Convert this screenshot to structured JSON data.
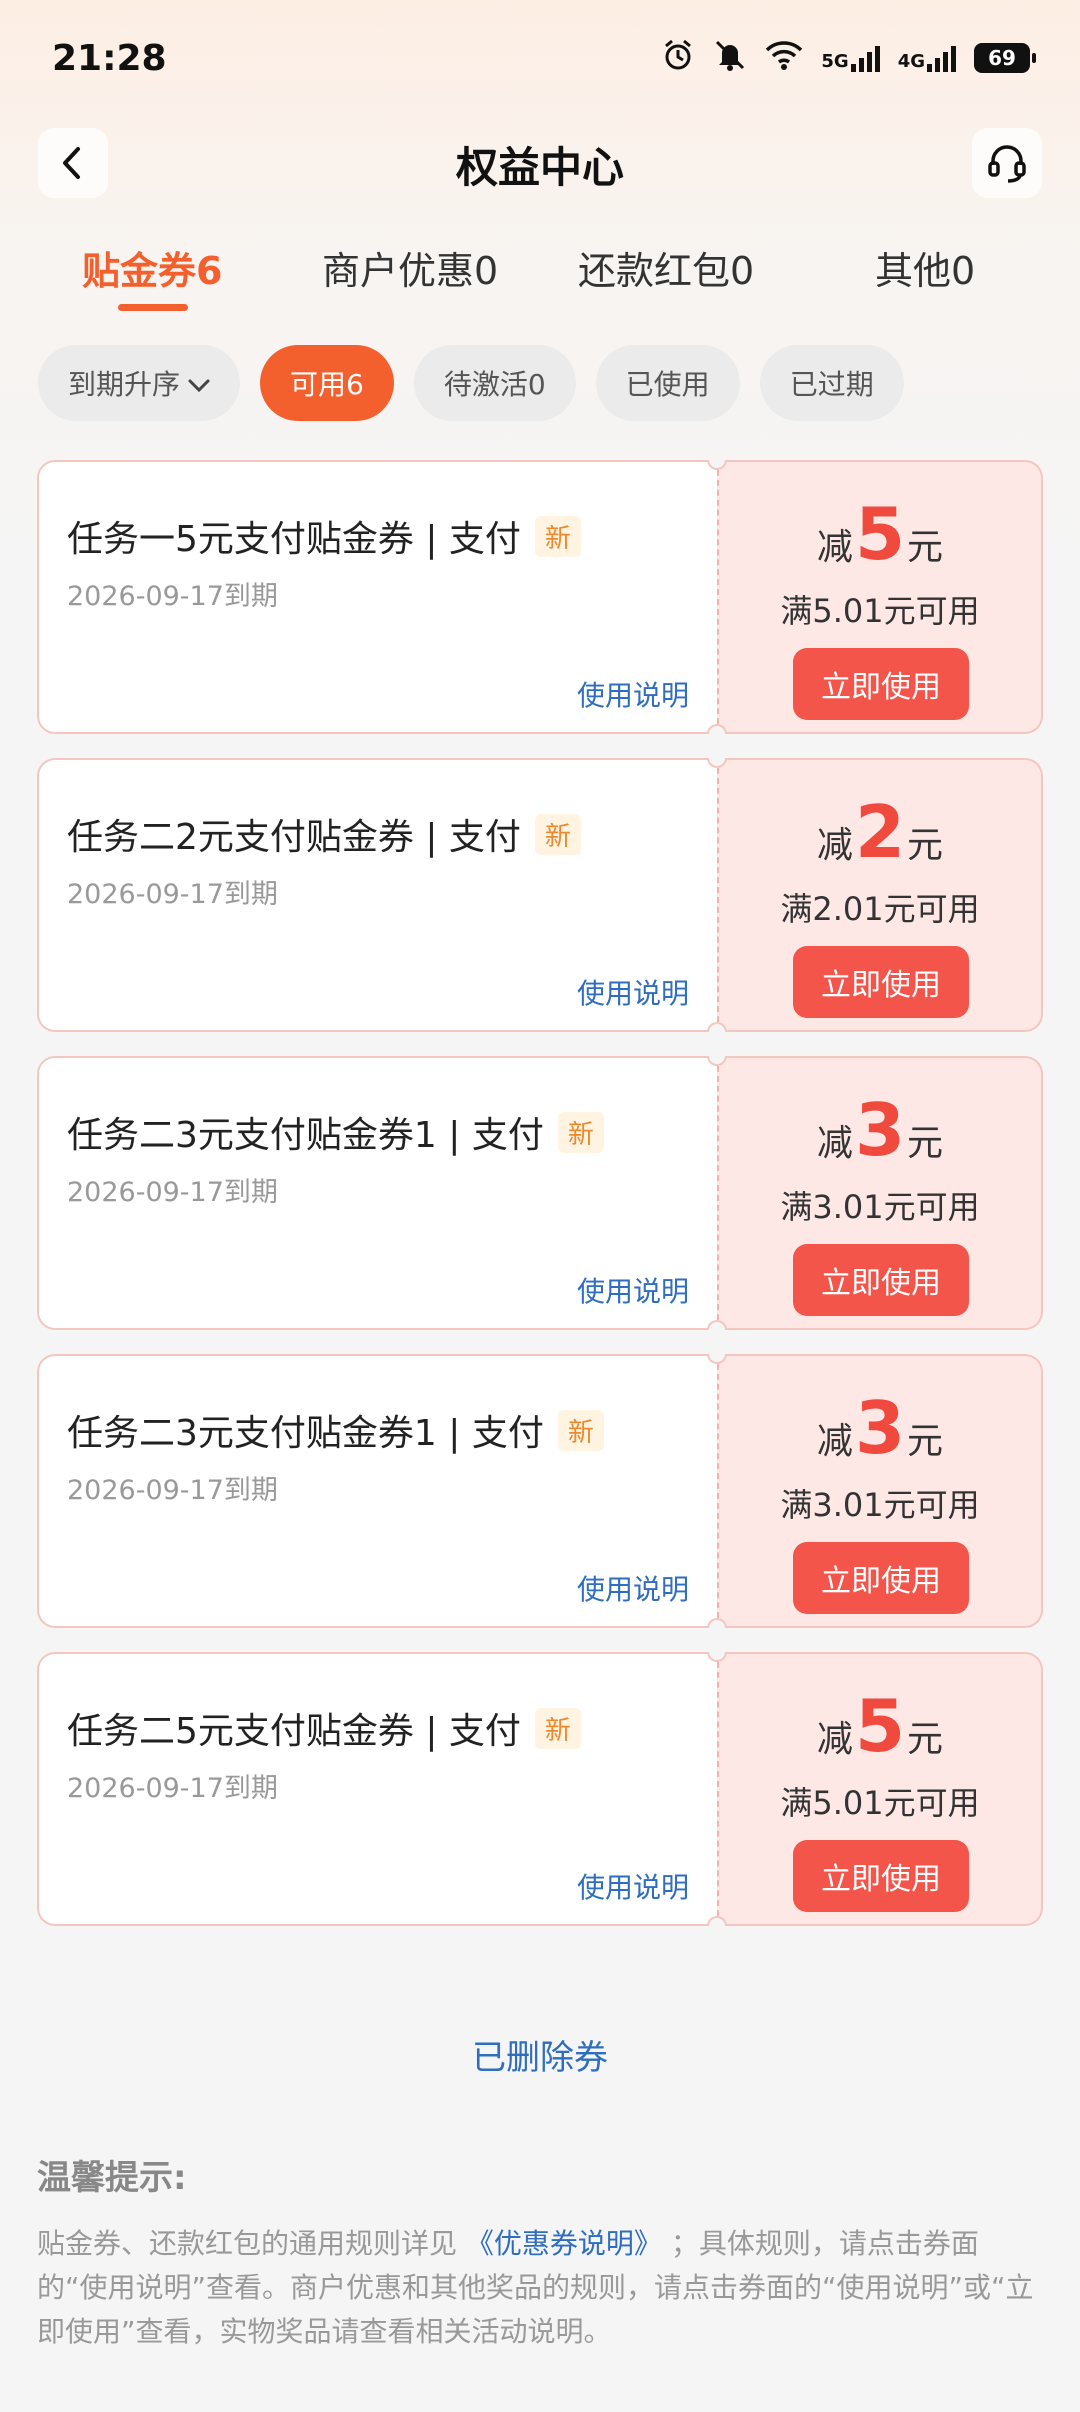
{
  "status": {
    "time": "21:28",
    "net1": "5G",
    "net2": "4G",
    "battery": "69"
  },
  "nav": {
    "title": "权益中心",
    "back_icon": "chevron-left-icon",
    "service_icon": "headset-icon"
  },
  "tabs": [
    {
      "label": "贴金券6",
      "active": true
    },
    {
      "label": "商户优惠0",
      "active": false
    },
    {
      "label": "还款红包0",
      "active": false
    },
    {
      "label": "其他0",
      "active": false
    }
  ],
  "filters": {
    "sort": "到期升序",
    "chips": [
      "可用6",
      "待激活0",
      "已使用",
      "已过期"
    ],
    "active_chip": "可用6"
  },
  "coupons": [
    {
      "title": "任务一5元支付贴金券 | 支付",
      "badge": "新",
      "expire": "2026-09-17到期",
      "help": "使用说明",
      "prefix": "减",
      "amount": "5",
      "suffix": "元",
      "condition": "满5.01元可用",
      "button": "立即使用"
    },
    {
      "title": "任务二2元支付贴金券 | 支付",
      "badge": "新",
      "expire": "2026-09-17到期",
      "help": "使用说明",
      "prefix": "减",
      "amount": "2",
      "suffix": "元",
      "condition": "满2.01元可用",
      "button": "立即使用"
    },
    {
      "title": "任务二3元支付贴金券1 | 支付",
      "badge": "新",
      "expire": "2026-09-17到期",
      "help": "使用说明",
      "prefix": "减",
      "amount": "3",
      "suffix": "元",
      "condition": "满3.01元可用",
      "button": "立即使用"
    },
    {
      "title": "任务二3元支付贴金券1 | 支付",
      "badge": "新",
      "expire": "2026-09-17到期",
      "help": "使用说明",
      "prefix": "减",
      "amount": "3",
      "suffix": "元",
      "condition": "满3.01元可用",
      "button": "立即使用"
    },
    {
      "title": "任务二5元支付贴金券 | 支付",
      "badge": "新",
      "expire": "2026-09-17到期",
      "help": "使用说明",
      "prefix": "减",
      "amount": "5",
      "suffix": "元",
      "condition": "满5.01元可用",
      "button": "立即使用"
    }
  ],
  "deleted_link": "已删除券",
  "tips": {
    "title": "温馨提示:",
    "text_before": "贴金券、还款红包的通用规则详见",
    "link": "《优惠券说明》",
    "text_after": "；具体规则，请点击券面的“使用说明”查看。商户优惠和其他奖品的规则，请点击券面的“使用说明”或“立即使用”查看，实物奖品请查看相关活动说明。"
  },
  "colors": {
    "accent": "#f4602d",
    "coupon_red": "#f04a3f",
    "button_red": "#f3554a",
    "link_blue": "#2f6ebf"
  }
}
